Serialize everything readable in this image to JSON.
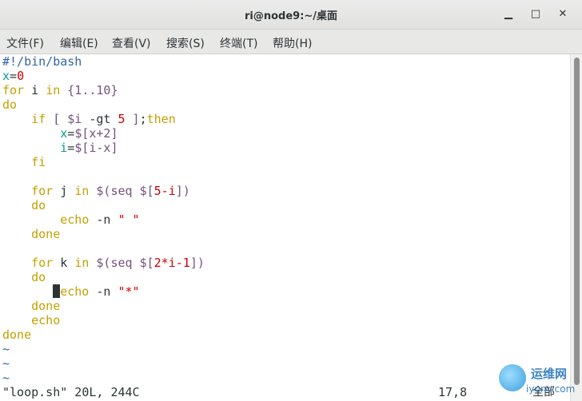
{
  "window": {
    "title": "ri@node9:~/桌面",
    "controls": {
      "minimize": "▁",
      "maximize": "□",
      "close": "✕"
    }
  },
  "menubar": [
    "文件(F)",
    "编辑(E)",
    "查看(V)",
    "搜索(S)",
    "终端(T)",
    "帮助(H)"
  ],
  "code_lines": [
    [
      [
        "#!/bin/bash",
        "com"
      ]
    ],
    [
      [
        "x",
        "var"
      ],
      [
        "=",
        "plain"
      ],
      [
        "0",
        "num"
      ]
    ],
    [
      [
        "for",
        "kw"
      ],
      [
        " i ",
        "plain"
      ],
      [
        "in",
        "kw"
      ],
      [
        " {1..10}",
        "ref"
      ]
    ],
    [
      [
        "do",
        "kw"
      ]
    ],
    [
      [
        "    ",
        "plain"
      ],
      [
        "if",
        "kw"
      ],
      [
        " [ ",
        "ref"
      ],
      [
        "$i",
        "ref"
      ],
      [
        " -gt ",
        "plain"
      ],
      [
        "5",
        "num"
      ],
      [
        " ]",
        "ref"
      ],
      [
        ";",
        "plain"
      ],
      [
        "then",
        "kw"
      ]
    ],
    [
      [
        "        ",
        "plain"
      ],
      [
        "x",
        "var"
      ],
      [
        "=",
        "plain"
      ],
      [
        "$[",
        "ref"
      ],
      [
        "x+2",
        "ref"
      ],
      [
        "]",
        "ref"
      ]
    ],
    [
      [
        "        ",
        "plain"
      ],
      [
        "i",
        "var"
      ],
      [
        "=",
        "plain"
      ],
      [
        "$[",
        "ref"
      ],
      [
        "i-x",
        "ref"
      ],
      [
        "]",
        "ref"
      ]
    ],
    [
      [
        "    ",
        "plain"
      ],
      [
        "fi",
        "kw"
      ]
    ],
    [
      [
        "",
        "plain"
      ]
    ],
    [
      [
        "    ",
        "plain"
      ],
      [
        "for",
        "kw"
      ],
      [
        " j ",
        "plain"
      ],
      [
        "in",
        "kw"
      ],
      [
        " $(",
        "ref"
      ],
      [
        "seq",
        "ref"
      ],
      [
        " $[",
        "ref"
      ],
      [
        "5-i",
        "num"
      ],
      [
        "]",
        "ref"
      ],
      [
        ")",
        "ref"
      ]
    ],
    [
      [
        "    ",
        "plain"
      ],
      [
        "do",
        "kw"
      ]
    ],
    [
      [
        "        ",
        "plain"
      ],
      [
        "echo",
        "kw"
      ],
      [
        " -n ",
        "plain"
      ],
      [
        "\" \"",
        "str"
      ]
    ],
    [
      [
        "    ",
        "plain"
      ],
      [
        "done",
        "kw"
      ]
    ],
    [
      [
        "",
        "plain"
      ]
    ],
    [
      [
        "    ",
        "plain"
      ],
      [
        "for",
        "kw"
      ],
      [
        " k ",
        "plain"
      ],
      [
        "in",
        "kw"
      ],
      [
        " $(",
        "ref"
      ],
      [
        "seq",
        "ref"
      ],
      [
        " $[",
        "ref"
      ],
      [
        "2*i-1",
        "num"
      ],
      [
        "]",
        "ref"
      ],
      [
        ")",
        "ref"
      ]
    ],
    [
      [
        "    ",
        "plain"
      ],
      [
        "do",
        "kw"
      ]
    ],
    [
      [
        "        ",
        "cursor"
      ],
      [
        "echo",
        "kw"
      ],
      [
        " -n ",
        "plain"
      ],
      [
        "\"*\"",
        "str"
      ]
    ],
    [
      [
        "    ",
        "plain"
      ],
      [
        "done",
        "kw"
      ]
    ],
    [
      [
        "    ",
        "plain"
      ],
      [
        "echo",
        "kw"
      ]
    ],
    [
      [
        "done",
        "kw"
      ]
    ],
    [
      [
        "~",
        "tilde"
      ]
    ],
    [
      [
        "~",
        "tilde"
      ]
    ],
    [
      [
        "~",
        "tilde"
      ]
    ]
  ],
  "status": {
    "file": "\"loop.sh\" 20L, 244C",
    "position": "17,8",
    "scope": "全部"
  },
  "watermark": {
    "line1": "运维网",
    "line2": "iyunv.com"
  },
  "colors": {
    "comment": "#3465a4",
    "variable": "#06989a",
    "number": "#cc0000",
    "keyword": "#c4a000",
    "reference": "#75507b"
  }
}
